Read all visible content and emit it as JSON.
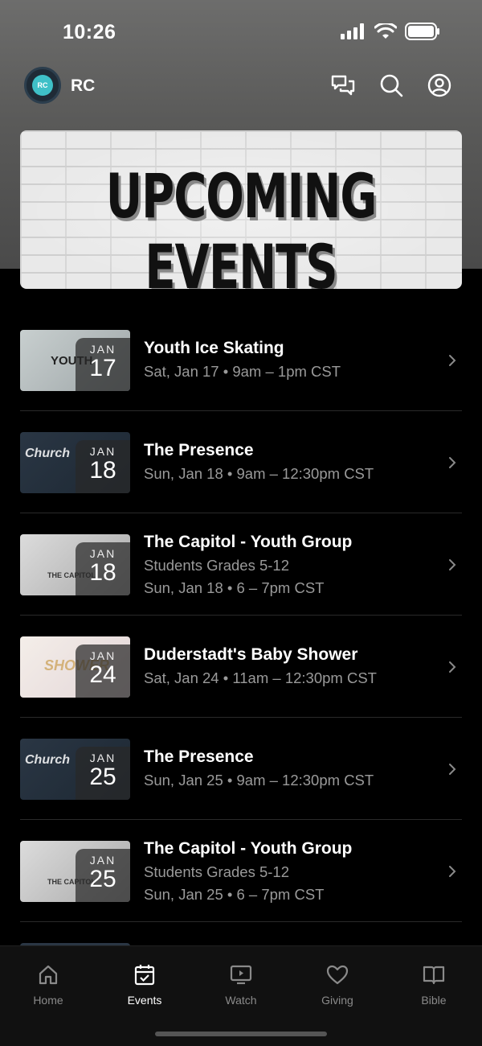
{
  "status_bar": {
    "time": "10:26"
  },
  "header": {
    "logo_text": "RC",
    "title": "RC",
    "icons": [
      "chat-icon",
      "search-icon",
      "profile-icon"
    ]
  },
  "banner": {
    "text": "UPCOMING EVENTS"
  },
  "events": [
    {
      "title": "Youth Ice Skating",
      "lines": [
        "Sat, Jan 17 • 9am – 1pm CST"
      ],
      "month": "JAN",
      "day": "17",
      "thumb": "youth",
      "thumb_text": "YOUTH"
    },
    {
      "title": "The Presence",
      "lines": [
        "Sun, Jan 18 • 9am – 12:30pm CST"
      ],
      "month": "JAN",
      "day": "18",
      "thumb": "presence",
      "thumb_text": "Church"
    },
    {
      "title": "The Capitol - Youth Group",
      "lines": [
        "Students Grades 5-12",
        "Sun, Jan 18 • 6 – 7pm CST"
      ],
      "month": "JAN",
      "day": "18",
      "thumb": "capitol",
      "thumb_text": "THE CAPITOL"
    },
    {
      "title": "Duderstadt's Baby Shower",
      "lines": [
        "Sat, Jan 24 • 11am – 12:30pm CST"
      ],
      "month": "JAN",
      "day": "24",
      "thumb": "baby",
      "thumb_text": "SHOWER"
    },
    {
      "title": "The Presence",
      "lines": [
        "Sun, Jan 25 • 9am – 12:30pm CST"
      ],
      "month": "JAN",
      "day": "25",
      "thumb": "presence",
      "thumb_text": "Church"
    },
    {
      "title": "The Capitol - Youth Group",
      "lines": [
        "Students Grades 5-12",
        "Sun, Jan 25 • 6 – 7pm CST"
      ],
      "month": "JAN",
      "day": "25",
      "thumb": "capitol",
      "thumb_text": "THE CAPITOL"
    }
  ],
  "tab_bar": {
    "tabs": [
      {
        "label": "Home",
        "icon": "home-icon",
        "active": false
      },
      {
        "label": "Events",
        "icon": "calendar-icon",
        "active": true
      },
      {
        "label": "Watch",
        "icon": "video-icon",
        "active": false
      },
      {
        "label": "Giving",
        "icon": "heart-icon",
        "active": false
      },
      {
        "label": "Bible",
        "icon": "book-icon",
        "active": false
      }
    ]
  }
}
